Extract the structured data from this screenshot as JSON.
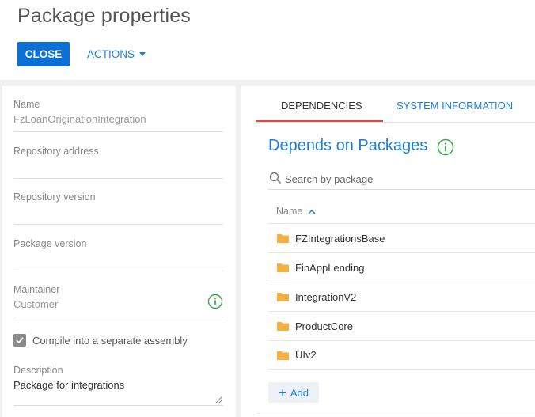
{
  "header": {
    "title": "Package properties",
    "close_label": "CLOSE",
    "actions_label": "ACTIONS"
  },
  "form": {
    "name": {
      "label": "Name",
      "value": "FzLoanOriginationIntegration"
    },
    "repository_address": {
      "label": "Repository address",
      "value": ""
    },
    "repository_version": {
      "label": "Repository version",
      "value": ""
    },
    "package_version": {
      "label": "Package version",
      "value": ""
    },
    "maintainer": {
      "label": "Maintainer",
      "value": "Customer"
    },
    "compile": {
      "label": "Compile into a separate assembly",
      "checked": true
    },
    "description": {
      "label": "Description",
      "value": "Package for integrations"
    }
  },
  "tabs": [
    {
      "label": "DEPENDENCIES",
      "active": true
    },
    {
      "label": "SYSTEM INFORMATION",
      "active": false
    }
  ],
  "dependencies": {
    "title": "Depends on Packages",
    "search_placeholder": "Search by package",
    "column_name": "Name",
    "packages": [
      "FZIntegrationsBase",
      "FinAppLending",
      "IntegrationV2",
      "ProductCore",
      "UIv2"
    ],
    "add_label": "Add"
  },
  "colors": {
    "accent": "#0c6fd6",
    "link": "#1f7fd3",
    "tab_active": "#e04a3a",
    "folder": "#f5b041",
    "info": "#3ca84a"
  }
}
